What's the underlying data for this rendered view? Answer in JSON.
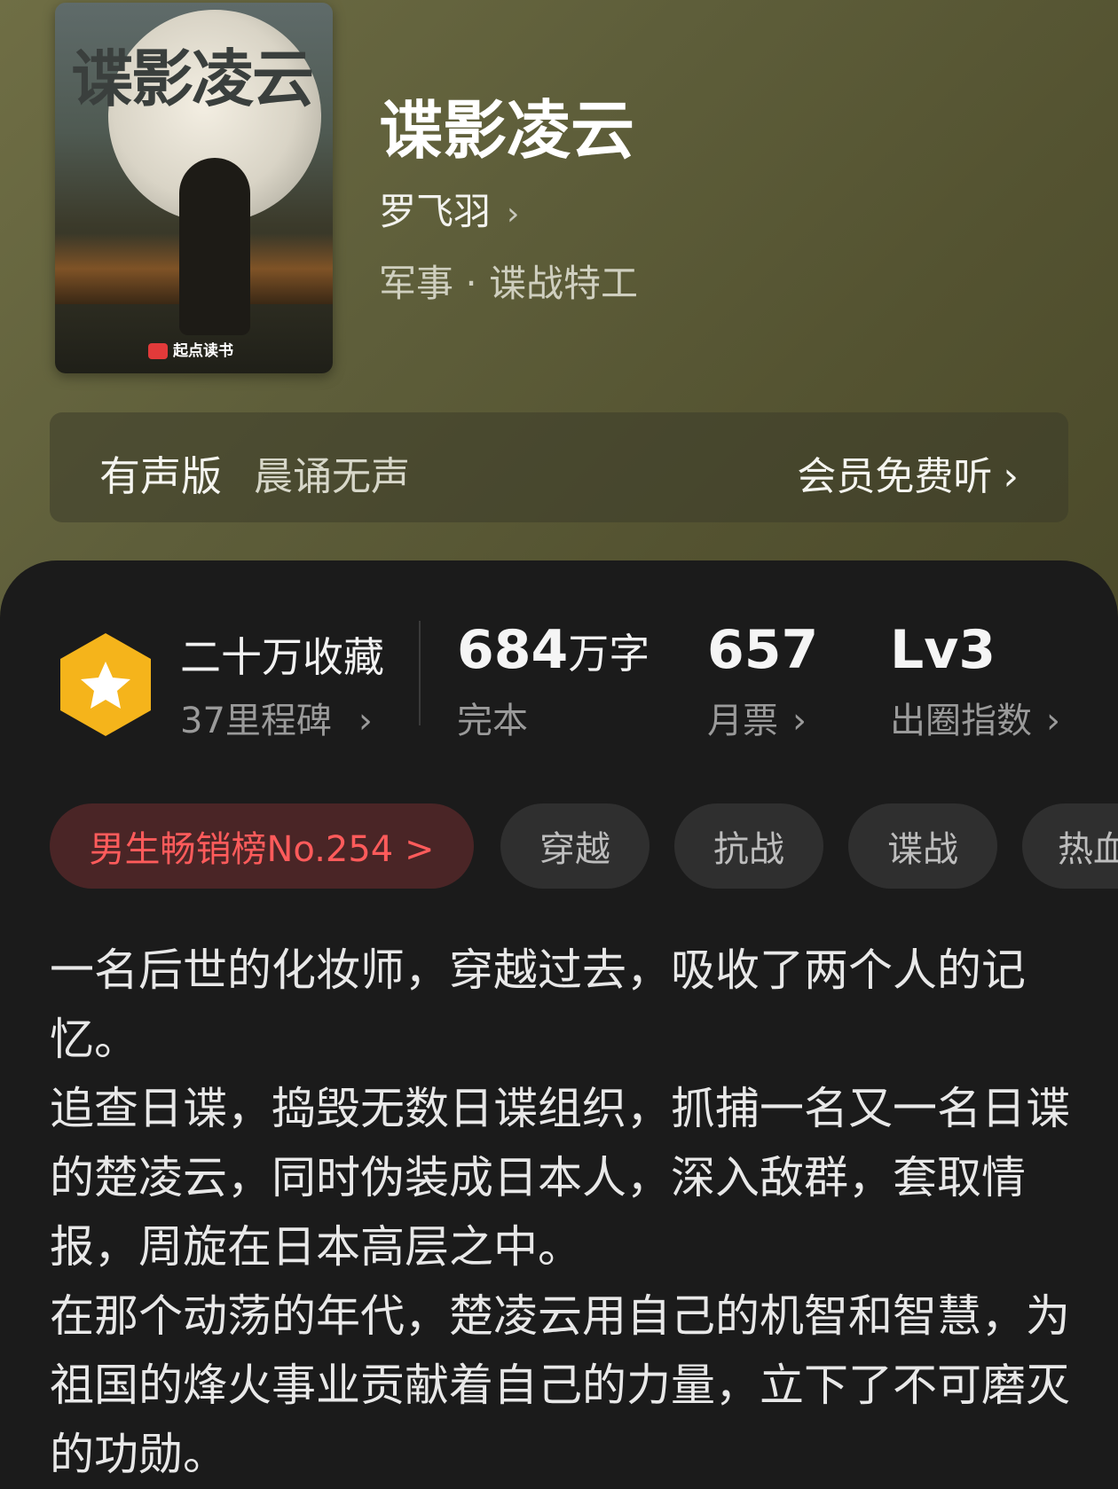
{
  "book": {
    "title": "谍影凌云",
    "author": "罗飞羽",
    "category": "军事 · 谍战特工",
    "cover": {
      "title_art": "谍影凌云",
      "publisher": "起点读书"
    }
  },
  "audio": {
    "label": "有声版",
    "narrator": "晨诵无声",
    "action": "会员免费听"
  },
  "stats": {
    "collections": "二十万收藏",
    "milestones": "37里程碑",
    "word_count": "684",
    "word_unit": "万字",
    "status": "完本",
    "monthly_votes": "657",
    "monthly_votes_label": "月票",
    "level": "Lv3",
    "level_label": "出圈指数"
  },
  "tags": {
    "rank": "男生畅销榜No.254 >",
    "items": [
      "穿越",
      "抗战",
      "谍战",
      "热血"
    ]
  },
  "description": [
    "一名后世的化妆师，穿越过去，吸收了两个人的记忆。",
    "追查日谍，捣毁无数日谍组织，抓捕一名又一名日谍的楚凌云，同时伪装成日本人，深入敌群，套取情报，周旋在日本高层之中。",
    "在那个动荡的年代，楚凌云用自己的机智和智慧，为祖国的烽火事业贡献着自己的力量，立下了不可磨灭的功勋。"
  ],
  "colors": {
    "header_bg": "#5e5e3a",
    "content_bg": "#1b1b1b",
    "badge": "#f5b41b",
    "rank_text": "#ff5b5b",
    "rank_bg": "#4a2526"
  },
  "icons": [
    "star-badge-icon",
    "chevron-right-icon"
  ]
}
